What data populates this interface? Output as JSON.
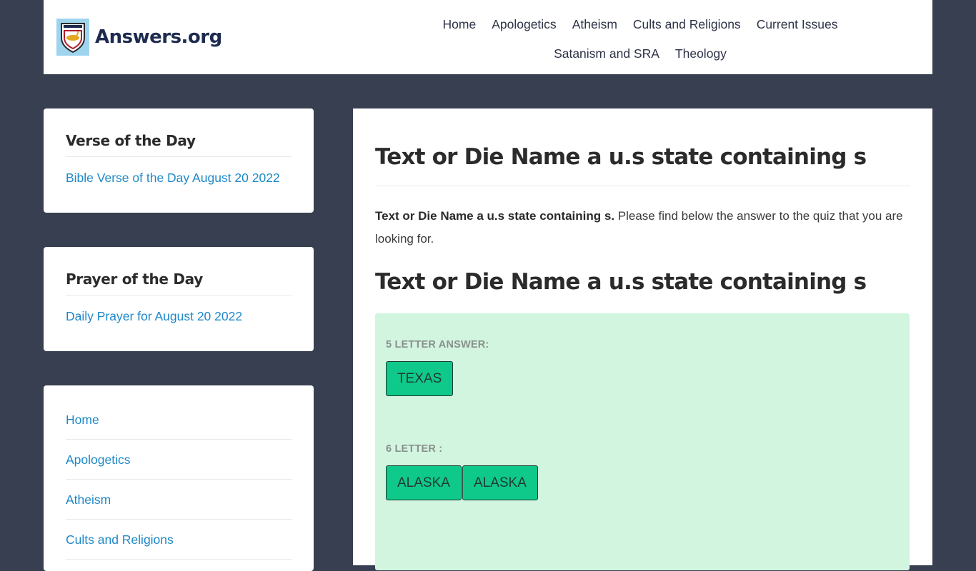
{
  "header": {
    "logo_text": "Answers.org",
    "nav": [
      "Home",
      "Apologetics",
      "Atheism",
      "Cults and Religions",
      "Current Issues",
      "Satanism and SRA",
      "Theology"
    ]
  },
  "sidebar": {
    "verse": {
      "title": "Verse of the Day",
      "link": "Bible Verse of the Day August 20 2022"
    },
    "prayer": {
      "title": "Prayer of the Day",
      "link": "Daily Prayer for August 20 2022"
    },
    "menu": [
      "Home",
      "Apologetics",
      "Atheism",
      "Cults and Religions"
    ]
  },
  "main": {
    "title": "Text or Die Name a u.s state containing s",
    "intro_bold": "Text or Die Name a u.s state containing s.",
    "intro_rest": " Please find below the answer to the quiz that you are looking for.",
    "subtitle": "Text or Die Name a u.s state containing s",
    "answers": [
      {
        "label": "5 LETTER ANSWER:",
        "words": [
          "TEXAS"
        ]
      },
      {
        "label": "6 LETTER :",
        "words": [
          "ALASKA",
          "ALASKA"
        ]
      }
    ]
  },
  "colors": {
    "background": "#373f51",
    "link": "#1e88c8",
    "answer_bg": "#d2f5e0",
    "tile": "#0fc98a"
  }
}
